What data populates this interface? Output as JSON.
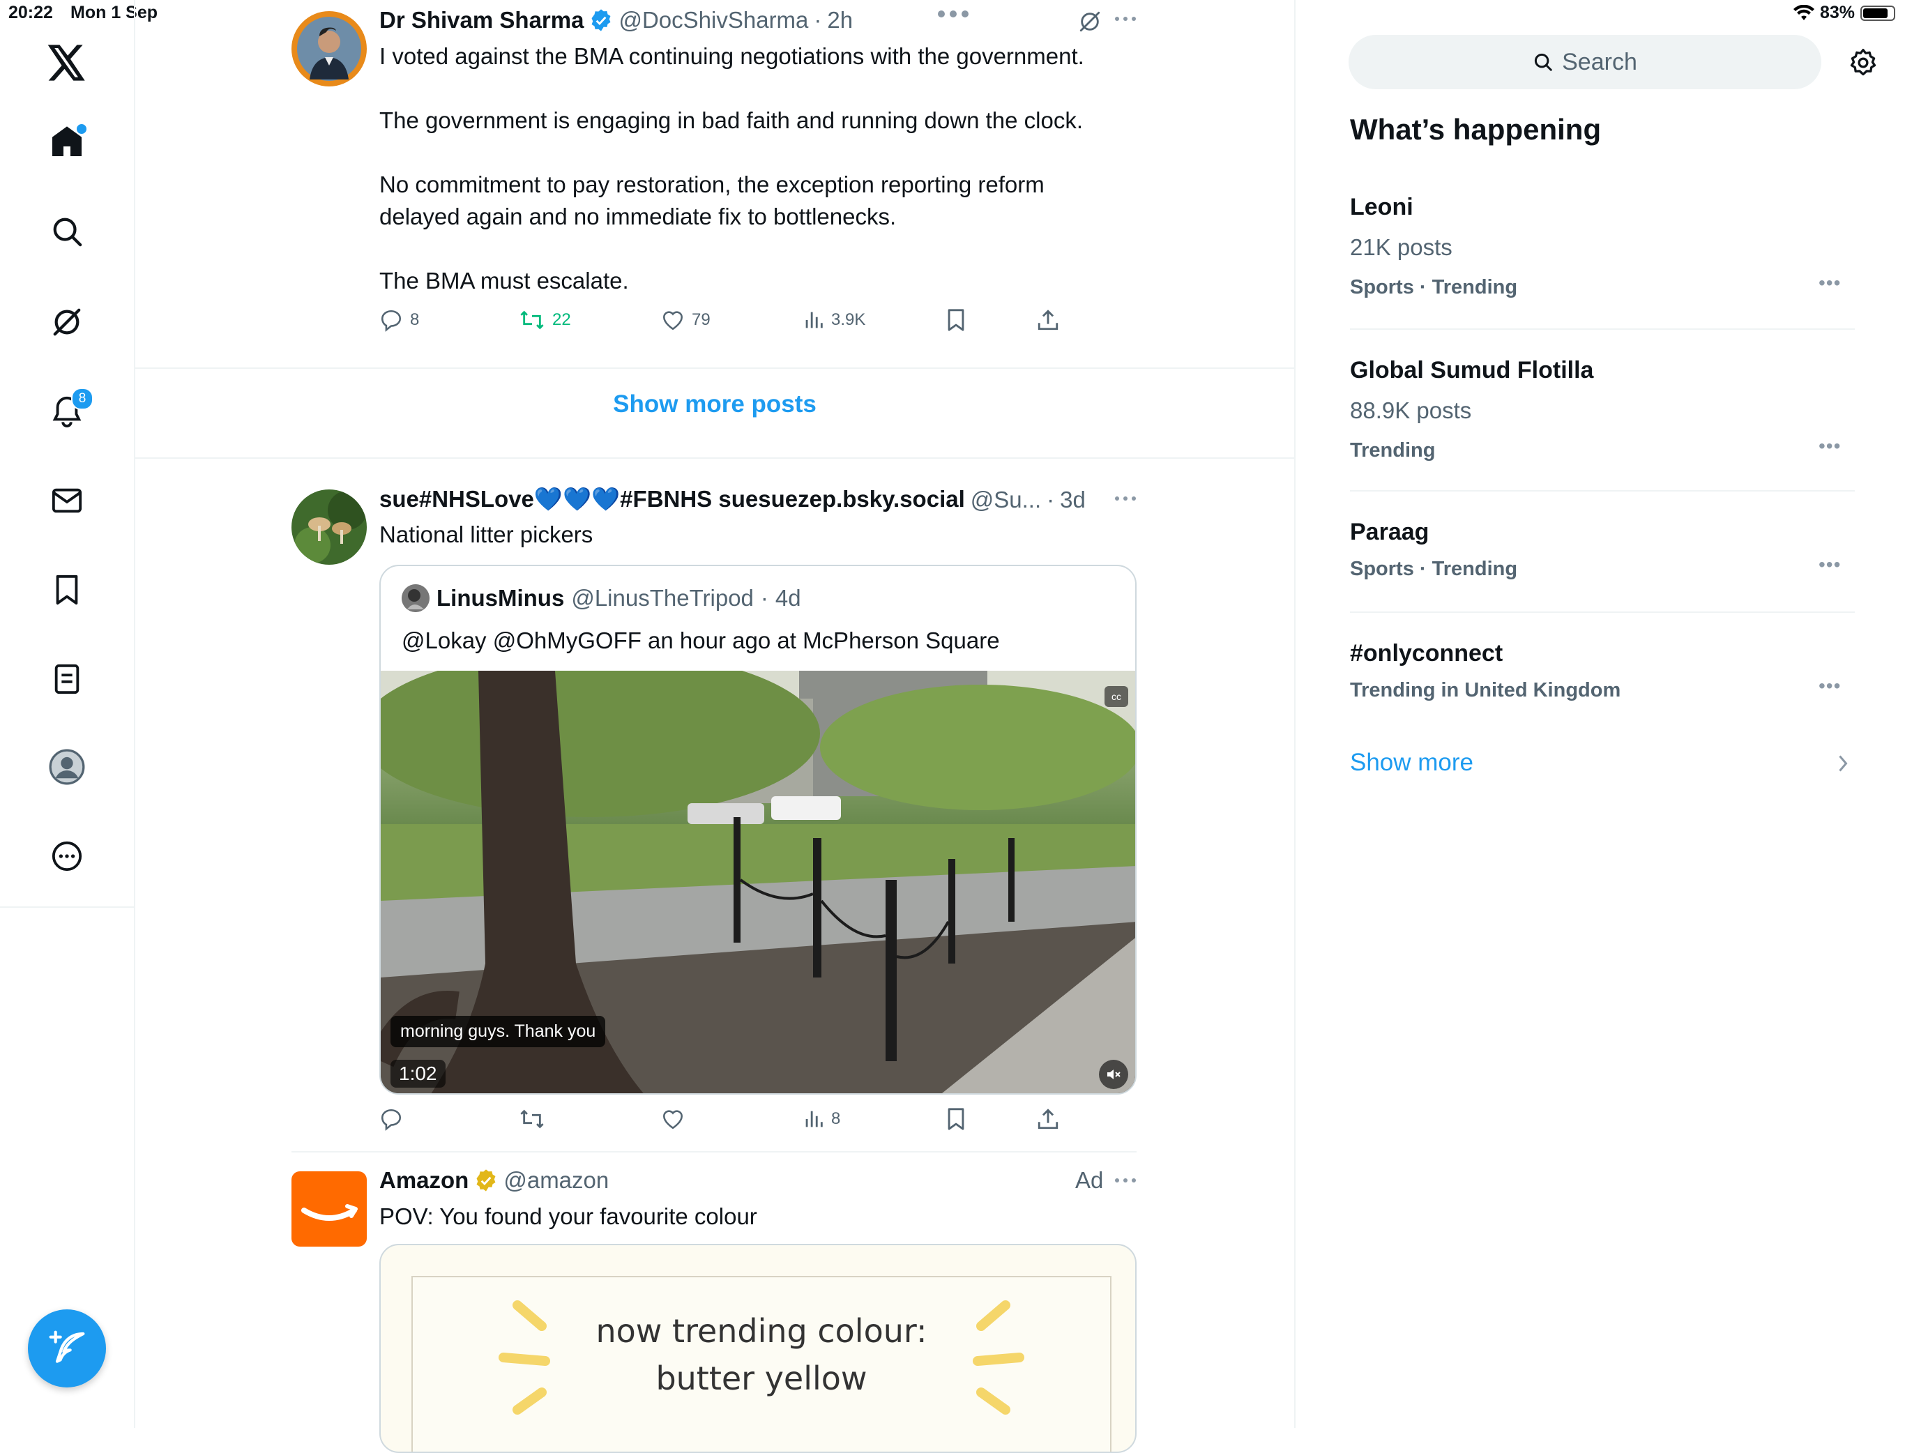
{
  "status_bar": {
    "time": "20:22",
    "date": "Mon 1 Sep",
    "battery": "83%",
    "battery_level": 0.83
  },
  "nav": {
    "notifications_count": "8",
    "items": [
      "x-logo",
      "home",
      "explore",
      "grok",
      "notifications",
      "messages",
      "bookmarks",
      "lists",
      "profile",
      "more"
    ]
  },
  "tweet1": {
    "name": "Dr Shivam Sharma",
    "handle": "@DocShivSharma",
    "time": "2h",
    "text": "I voted against the BMA continuing negotiations with the government.\n\nThe government is engaging in bad faith and running down the clock.\n\nNo commitment to pay restoration, the exception reporting reform\ndelayed again and no immediate fix to bottlenecks.\n\nThe BMA must escalate.",
    "replies": "8",
    "reposts": "22",
    "likes": "79",
    "views": "3.9K"
  },
  "show_more_posts": "Show more posts",
  "tweet2": {
    "name": "sue#NHSLove💙💙💙#FBNHS suesuezep.bsky.social",
    "handle": "@Su...",
    "time": "3d",
    "text": "National litter pickers",
    "views": "8",
    "quote": {
      "name": "LinusMinus",
      "handle": "@LinusTheTripod",
      "time": "4d",
      "text": "@Lokay @OhMyGOFF an hour ago at McPherson Square",
      "caption": "morning guys. Thank you",
      "duration": "1:02"
    }
  },
  "tweet3": {
    "name": "Amazon",
    "handle": "@amazon",
    "ad_label": "Ad",
    "text": "POV: You found your favourite colour",
    "card_line1": "now trending colour:",
    "card_line2": "butter yellow"
  },
  "right": {
    "search_placeholder": "Search",
    "whats_happening": "What’s happening",
    "trends": [
      {
        "title": "Leoni",
        "posts": "21K posts",
        "meta": "Sports · Trending"
      },
      {
        "title": "Global Sumud Flotilla",
        "posts": "88.9K posts",
        "meta": "Trending"
      },
      {
        "title": "Paraag",
        "posts": "",
        "meta": "Sports · Trending"
      },
      {
        "title": "#onlyconnect",
        "posts": "",
        "meta": "Trending in United Kingdom"
      }
    ],
    "show_more": "Show more"
  },
  "colors": {
    "accent": "#1d9bf0",
    "repost_active": "#00ba7c",
    "amazon": "#ff6a00",
    "gold_badge": "#e2b719"
  }
}
